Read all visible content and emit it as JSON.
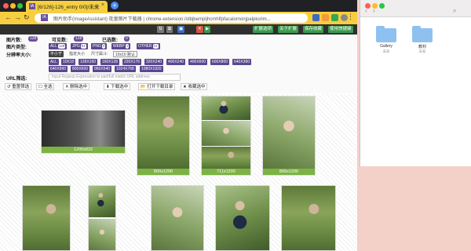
{
  "browser": {
    "tab_title": "[6/126]-126_entry 0/0]/未来/...",
    "new_tab": "+",
    "url": "图片助手(ImageAssistant) 批量图片下载器 | chrome-extension://dbjbempljhcmhlfpfacalomonjpalpko/im...",
    "menu": "⋮"
  },
  "toolbar": {
    "buttons": [
      "扩展选项",
      "关于扩展",
      "保存收藏",
      "使用快捷键"
    ]
  },
  "panel": {
    "image_count_label": "图片数:",
    "image_count": "128",
    "visible_count_label": "可见数:",
    "visible_count": "128",
    "selected_count_label": "已选数:",
    "selected_count": "0",
    "image_type_label": "图片类型:",
    "types": [
      {
        "name": "ALL",
        "count": "128"
      },
      {
        "name": "JPG",
        "count": "61"
      },
      {
        "name": "PNG",
        "count": "0"
      },
      {
        "name": "WEBP",
        "count": "1"
      },
      {
        "name": "OTHER",
        "count": "41"
      }
    ],
    "resolution_label": "分辨率大小:",
    "size_mode": "不小于",
    "size_mode_alt": "指定大小",
    "size_display_label": "尺寸属斗:",
    "size_display_value": "10x10 默认",
    "sizes_row1": [
      "ALL",
      "10X10",
      "128X160",
      "160X128",
      "220X176",
      "320X240",
      "400X240",
      "400X600",
      "600X800",
      "640X360"
    ],
    "sizes_row2": [
      "640X960",
      "800X600",
      "960X540",
      "1024X768",
      "1080X1920"
    ],
    "url_filter_label": "URL筛选:",
    "url_filter_placeholder": "Input Regexp Expression to part/full match URL address.",
    "actions": [
      "重置筛选",
      "全选",
      "删除选中",
      "下载选中",
      "打开下载目录",
      "收藏选中"
    ]
  },
  "gallery": {
    "captions": [
      "1200x822",
      "800x1200",
      "711x1200",
      "800x1200"
    ]
  },
  "finder": {
    "folders": [
      {
        "name": "Gallery",
        "sub": "未知"
      },
      {
        "name": "教材",
        "sub": "未知"
      }
    ]
  }
}
